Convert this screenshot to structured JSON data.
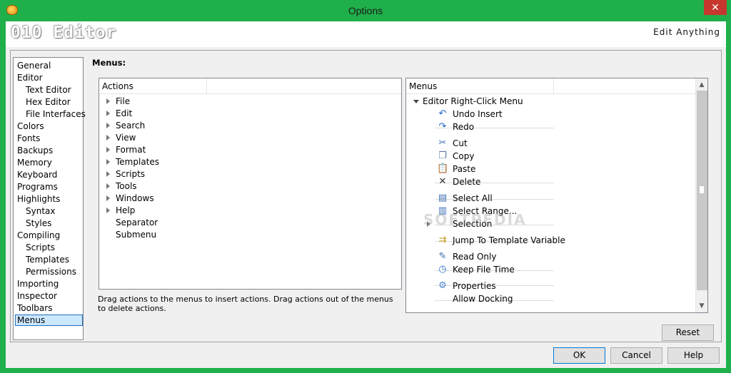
{
  "window": {
    "title": "Options",
    "close_glyph": "✕",
    "app_icon": "app-icon"
  },
  "banner": {
    "logo_text": "010 Editor",
    "tagline": "Edit Anything"
  },
  "nav": {
    "items": [
      {
        "label": "General"
      },
      {
        "label": "Editor"
      },
      {
        "label": "Text Editor"
      },
      {
        "label": "Hex Editor"
      },
      {
        "label": "File Interfaces"
      },
      {
        "label": "Colors"
      },
      {
        "label": "Fonts"
      },
      {
        "label": "Backups"
      },
      {
        "label": "Memory"
      },
      {
        "label": "Keyboard"
      },
      {
        "label": "Programs"
      },
      {
        "label": "Highlights"
      },
      {
        "label": "Syntax"
      },
      {
        "label": "Styles"
      },
      {
        "label": "Compiling"
      },
      {
        "label": "Scripts"
      },
      {
        "label": "Templates"
      },
      {
        "label": "Permissions"
      },
      {
        "label": "Importing"
      },
      {
        "label": "Inspector"
      },
      {
        "label": "Toolbars"
      },
      {
        "label": "Menus"
      }
    ],
    "selected": "Menus"
  },
  "page": {
    "heading": "Menus:",
    "hint": "Drag actions to the menus to insert actions. Drag actions out of the menus to delete actions."
  },
  "actions": {
    "header": "Actions",
    "items": [
      {
        "label": "File"
      },
      {
        "label": "Edit"
      },
      {
        "label": "Search"
      },
      {
        "label": "View"
      },
      {
        "label": "Format"
      },
      {
        "label": "Templates"
      },
      {
        "label": "Scripts"
      },
      {
        "label": "Tools"
      },
      {
        "label": "Windows"
      },
      {
        "label": "Help"
      },
      {
        "label": "Separator"
      },
      {
        "label": "Submenu"
      }
    ]
  },
  "menus": {
    "header": "Menus",
    "root": "Editor Right-Click Menu",
    "items": [
      {
        "label": "Undo Insert",
        "icon": "undo-icon"
      },
      {
        "label": "Redo",
        "icon": "redo-icon"
      },
      {
        "label": "Cut",
        "icon": "cut-icon"
      },
      {
        "label": "Copy",
        "icon": "copy-icon"
      },
      {
        "label": "Paste",
        "icon": "paste-icon"
      },
      {
        "label": "Delete",
        "icon": "delete-icon"
      },
      {
        "label": "Select All",
        "icon": "select-all-icon"
      },
      {
        "label": "Select Range...",
        "icon": "select-range-icon"
      },
      {
        "label": "Selection",
        "icon": ""
      },
      {
        "label": "Jump To Template Variable",
        "icon": "template-variable-icon"
      },
      {
        "label": "Read Only",
        "icon": "read-only-icon"
      },
      {
        "label": "Keep File Time",
        "icon": "keep-file-time-icon"
      },
      {
        "label": "Properties",
        "icon": "properties-icon"
      },
      {
        "label": "Allow Docking",
        "icon": ""
      }
    ]
  },
  "buttons": {
    "reset": "Reset",
    "ok": "OK",
    "cancel": "Cancel",
    "help": "Help"
  },
  "watermark": "SOFTPEDIA"
}
